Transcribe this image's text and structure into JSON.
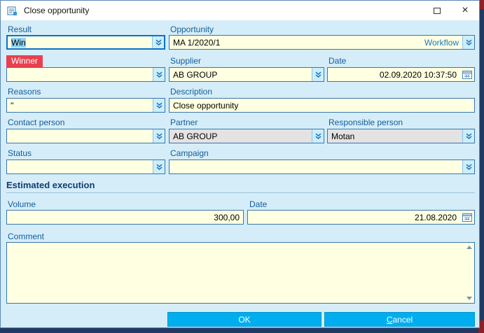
{
  "window": {
    "title": "Close opportunity"
  },
  "icons": {
    "dropdown": "chevron-double-down",
    "calendar": "calendar-grid",
    "maximize": "square-outline",
    "close": "×",
    "scroll_up": "triangle-up",
    "scroll_down": "triangle-down"
  },
  "colors": {
    "accent": "#00aeef",
    "dialog_bg": "#d5edf8",
    "field_bg": "#ffffe1",
    "label": "#155c9a",
    "winner_bg": "#e8404f",
    "disabled_bg": "#e3e3e3"
  },
  "fields": {
    "result": {
      "label": "Result",
      "value": "Win"
    },
    "opportunity": {
      "label": "Opportunity",
      "value": "MA 1/2020/1",
      "link": "Workflow"
    },
    "winner": {
      "label": "Winner",
      "value": ""
    },
    "supplier": {
      "label": "Supplier",
      "value": "AB GROUP"
    },
    "date": {
      "label": "Date",
      "value": "02.09.2020 10:37:50"
    },
    "reasons": {
      "label": "Reasons",
      "value": "''"
    },
    "description": {
      "label": "Description",
      "value": "Close opportunity"
    },
    "contact_person": {
      "label": "Contact person",
      "value": ""
    },
    "partner": {
      "label": "Partner",
      "value": "AB GROUP"
    },
    "responsible_person": {
      "label": "Responsible person",
      "value": "Motan"
    },
    "status": {
      "label": "Status",
      "value": ""
    },
    "campaign": {
      "label": "Campaign",
      "value": ""
    }
  },
  "section": {
    "title": "Estimated execution"
  },
  "estimated": {
    "volume": {
      "label": "Volume",
      "value": "300,00"
    },
    "date": {
      "label": "Date",
      "value": "21.08.2020"
    }
  },
  "comment": {
    "label": "Comment",
    "value": ""
  },
  "buttons": {
    "ok": "OK",
    "cancel": "Cancel",
    "cancel_initial": "C",
    "cancel_rest": "ancel"
  }
}
